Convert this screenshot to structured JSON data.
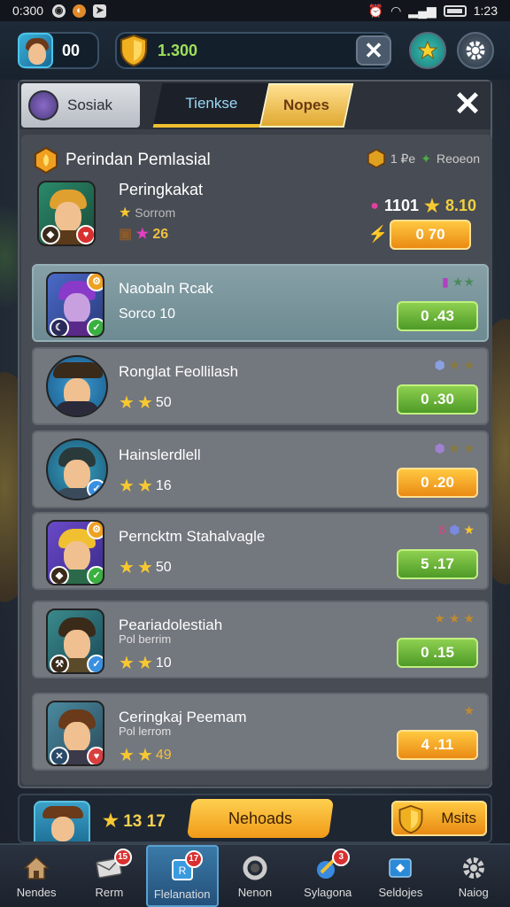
{
  "status_bar": {
    "time": "0:300",
    "clock": "1:23"
  },
  "top_bar": {
    "level": "00",
    "currency": "1.300"
  },
  "tabs": {
    "social": "Sosiak",
    "tienkse": "Tienkse",
    "nopes": "Nopes"
  },
  "list": {
    "title": "Perindan Pemlasial",
    "meta_count": "1 ₽e",
    "meta_label": "Reoeon"
  },
  "featured": {
    "name": "Peringkakat",
    "sub": "Sorrom",
    "stars": "26",
    "hp": "1101",
    "score": "8.10",
    "button": "0 70"
  },
  "rows": [
    {
      "name": "Naobaln Rcak",
      "sub": "",
      "stats": "Sorco 10",
      "button": "0 .43",
      "button_color": "green",
      "highlight": true
    },
    {
      "name": "Ronglat Feollilash",
      "sub": "",
      "stats": "50",
      "button": "0 .30",
      "button_color": "green"
    },
    {
      "name": "Hainslerdlell",
      "sub": "",
      "stats": "16",
      "button": "0 .20",
      "button_color": "orange"
    },
    {
      "name": "Perncktm Stahalvagle",
      "sub": "",
      "stats": "50",
      "button": "5 .17",
      "button_color": "green"
    },
    {
      "name": "Peariadolestiah",
      "sub": "Pol berrim",
      "stats": "10",
      "button": "0 .15",
      "button_color": "green"
    },
    {
      "name": "Ceringkaj Peemam",
      "sub": "Pol lerrom",
      "stats": "49",
      "button": "4 .11",
      "button_color": "orange"
    }
  ],
  "player_bar": {
    "points": "13 17",
    "main_button": "Nehoads",
    "side_button": "Msits"
  },
  "nav": [
    {
      "label": "Nendes",
      "badge": ""
    },
    {
      "label": "Rerm",
      "badge": "15"
    },
    {
      "label": "Flelanation",
      "badge": "17"
    },
    {
      "label": "Nenon",
      "badge": ""
    },
    {
      "label": "Sylagona",
      "badge": "3"
    },
    {
      "label": "Seldojes",
      "badge": ""
    },
    {
      "label": "Naiog",
      "badge": ""
    }
  ]
}
